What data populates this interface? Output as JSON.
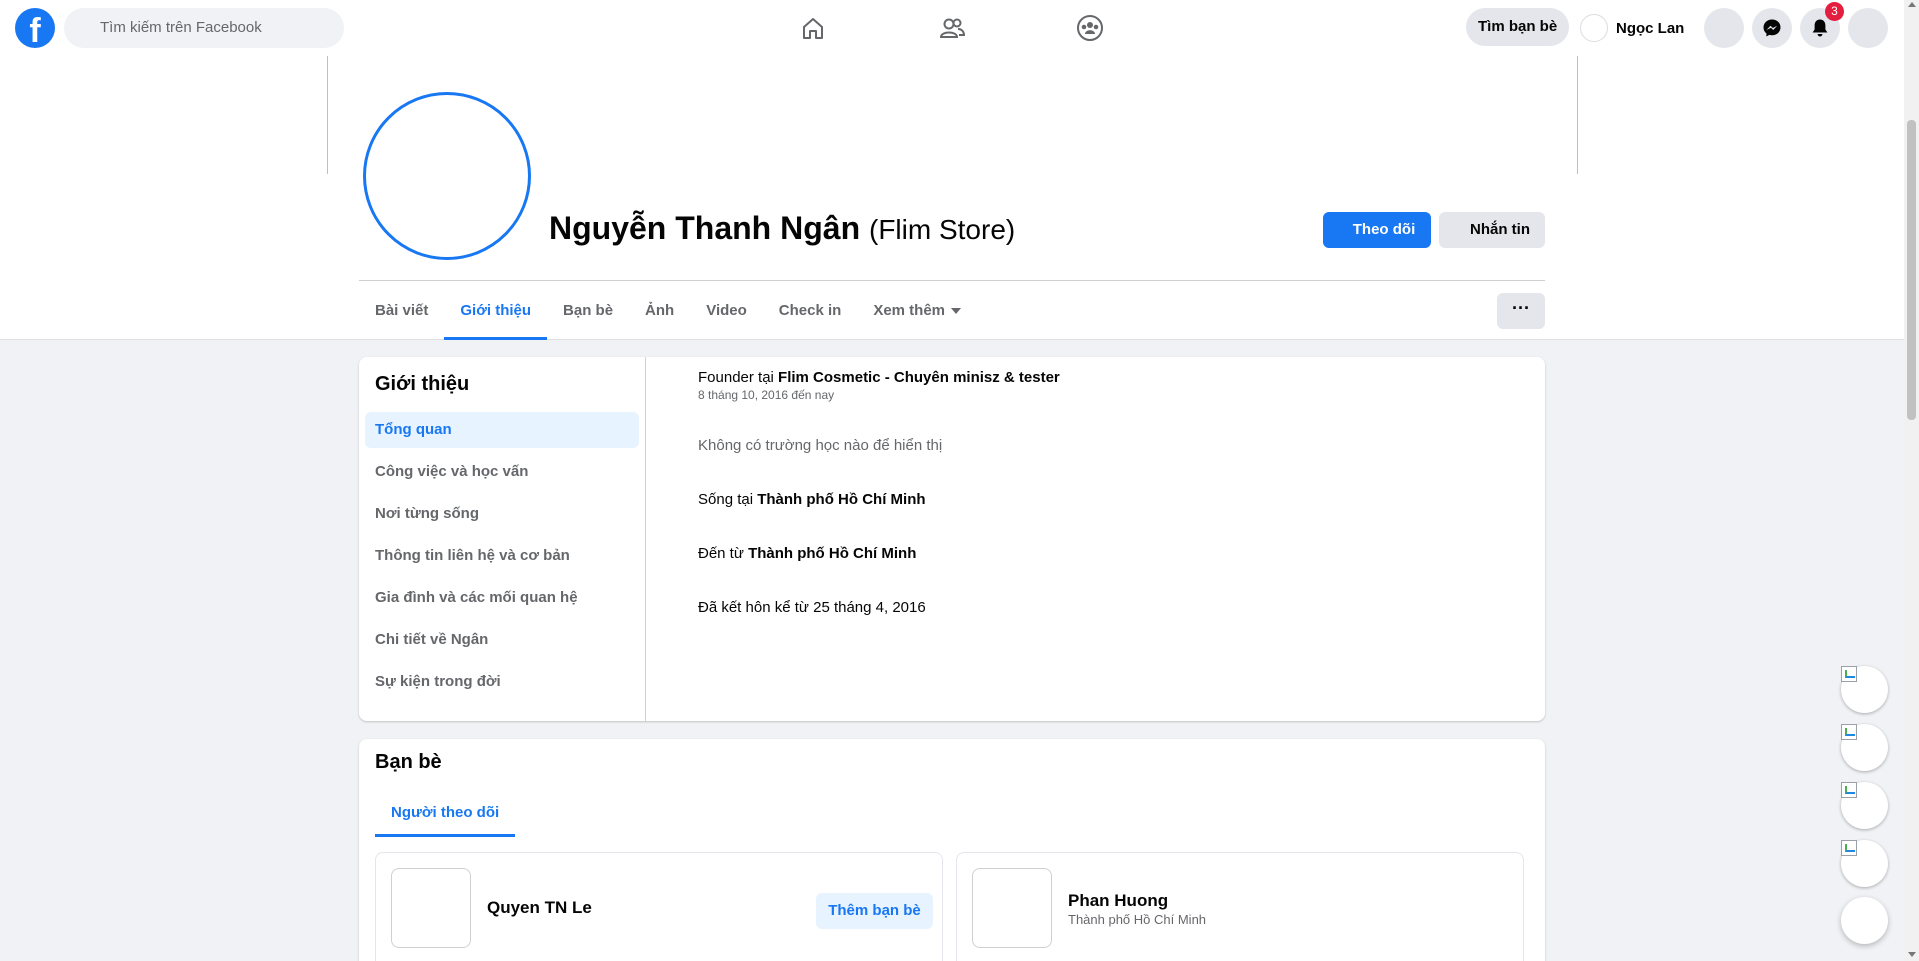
{
  "topbar": {
    "logo": "f",
    "search_placeholder": "Tìm kiếm trên Facebook",
    "find_friends_label": "Tìm bạn bè",
    "user_name": "Ngọc Lan",
    "notifications_count": "3",
    "icons": [
      "home-icon",
      "friends-icon",
      "groups-icon",
      "menu-icon",
      "messenger-icon",
      "bell-icon",
      "account-icon"
    ]
  },
  "profile": {
    "name": "Nguyễn Thanh Ngân",
    "alt_name": "(Flim Store)",
    "follow_label": "Theo dõi",
    "message_label": "Nhắn tin",
    "more_label": "···"
  },
  "tabs": [
    "Bài viết",
    "Giới thiệu",
    "Bạn bè",
    "Ảnh",
    "Video",
    "Check in",
    "Xem thêm"
  ],
  "about": {
    "title": "Giới thiệu",
    "menu": [
      "Tổng quan",
      "Công việc và học vấn",
      "Nơi từng sống",
      "Thông tin liên hệ và cơ bản",
      "Gia đình và các mối quan hệ",
      "Chi tiết về Ngân",
      "Sự kiện trong đời"
    ],
    "work_prefix": "Founder tại ",
    "work_place": "Flim Cosmetic - Chuyên minisz & tester",
    "work_dates": "8 tháng 10, 2016 đến nay",
    "school": "Không có trường học nào để hiển thị",
    "lives_prefix": "Sống tại ",
    "lives_place": "Thành phố Hồ Chí Minh",
    "from_prefix": "Đến từ ",
    "from_place": "Thành phố Hồ Chí Minh",
    "relationship": "Đã kết hôn kể từ 25 tháng 4, 2016"
  },
  "friends": {
    "title": "Bạn bè",
    "tab_label": "Người theo dõi",
    "items": [
      {
        "name": "Quyen TN Le",
        "sub": "",
        "action": "Thêm bạn bè"
      },
      {
        "name": "Phan Huong",
        "sub": "Thành phố Hồ Chí Minh",
        "action": ""
      }
    ]
  },
  "colors": {
    "accent": "#1877f2",
    "badge": "#e41e3f",
    "background": "#f0f2f5"
  }
}
